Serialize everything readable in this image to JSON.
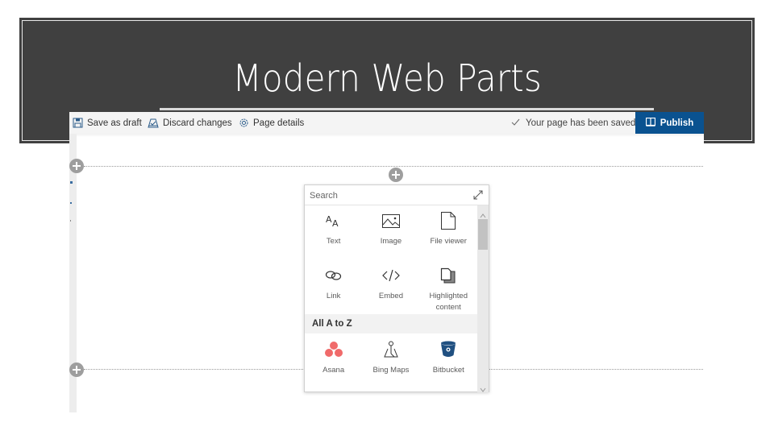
{
  "slide": {
    "title": "Modern Web Parts",
    "background_color": "#404040"
  },
  "command_bar": {
    "save_as_draft": "Save as draft",
    "discard_changes": "Discard changes",
    "page_details": "Page details",
    "status": "Your page has been saved",
    "publish": "Publish",
    "publish_color": "#0a5290"
  },
  "toolbox": {
    "search_placeholder": "Search",
    "featured": [
      {
        "label": "Text",
        "icon": "text-icon"
      },
      {
        "label": "Image",
        "icon": "image-icon"
      },
      {
        "label": "File viewer",
        "icon": "file-viewer-icon"
      },
      {
        "label": "Link",
        "icon": "link-icon"
      },
      {
        "label": "Embed",
        "icon": "embed-icon"
      },
      {
        "label": "Highlighted content",
        "icon": "highlighted-content-icon"
      }
    ],
    "section_header": "All A to Z",
    "a_to_z": [
      {
        "label": "Asana",
        "icon": "asana-icon"
      },
      {
        "label": "Bing Maps",
        "icon": "bing-maps-icon"
      },
      {
        "label": "Bitbucket",
        "icon": "bitbucket-icon"
      }
    ]
  }
}
